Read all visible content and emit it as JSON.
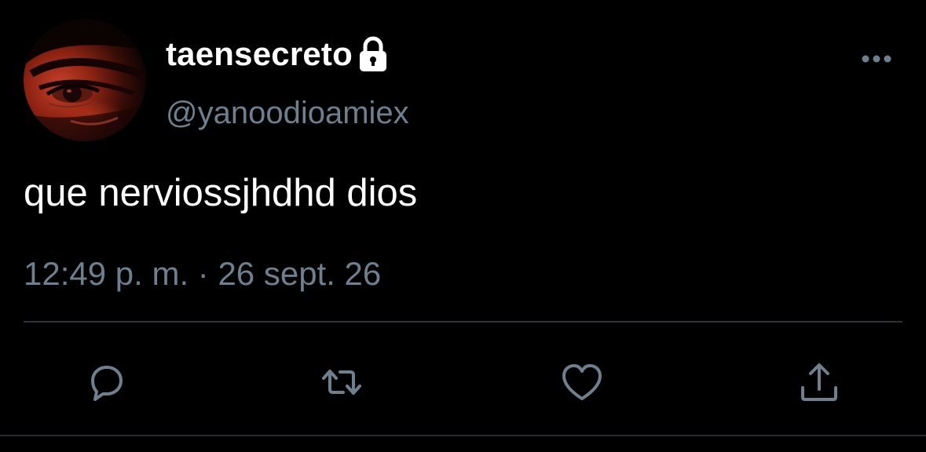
{
  "user": {
    "display_name": "taensecreto",
    "handle": "@yanoodioamiex",
    "protected_icon": "lock-icon",
    "avatar": "profile-photo"
  },
  "tweet": {
    "text": "que nerviossjhdhd dios",
    "timestamp": "12:49 p. m. · 26 sept. 26"
  },
  "actions": {
    "more_icon": "more-horizontal-icon",
    "reply_icon": "reply-icon",
    "retweet_icon": "retweet-icon",
    "like_icon": "heart-icon",
    "share_icon": "share-icon"
  },
  "colors": {
    "background": "#000000",
    "primary_text": "#ffffff",
    "secondary_text": "#6e7f8e",
    "divider": "#2f3336"
  }
}
